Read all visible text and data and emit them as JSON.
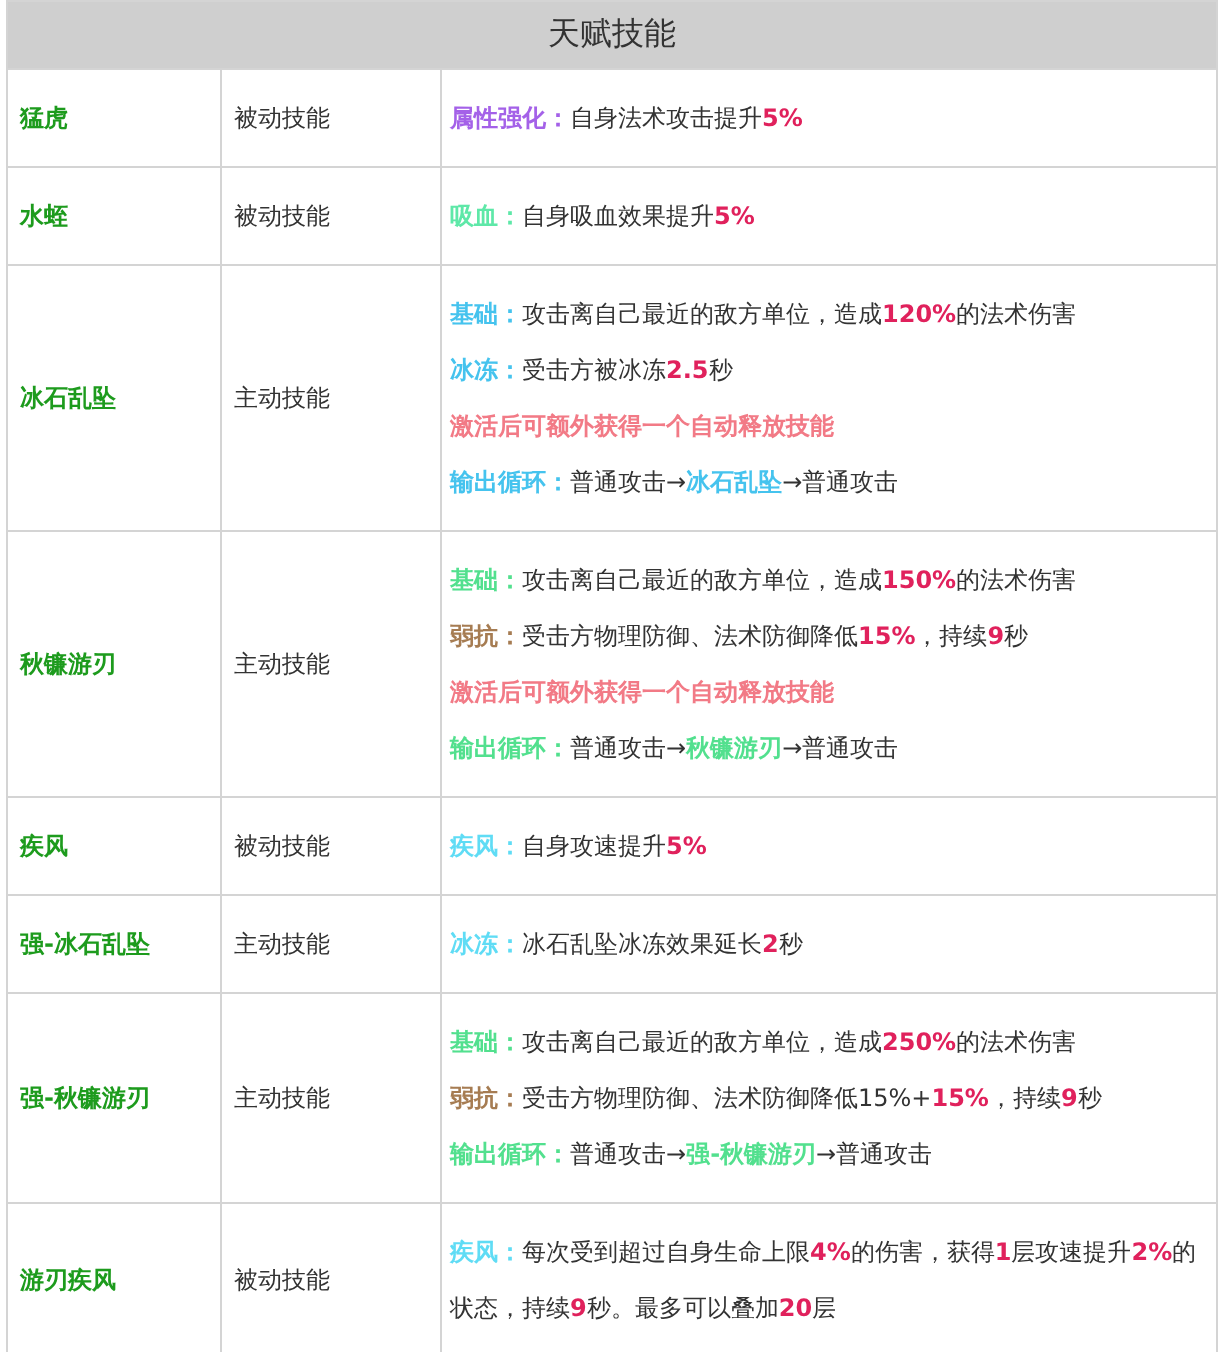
{
  "table": {
    "title": "天赋技能",
    "rows": [
      {
        "name": "猛虎",
        "type": "被动技能",
        "lines": [
          [
            {
              "kind": "label",
              "text": "属性强化：",
              "color": "#a461e8"
            },
            {
              "kind": "plain",
              "text": "自身法术攻击提升"
            },
            {
              "kind": "number",
              "text": "5%"
            }
          ]
        ]
      },
      {
        "name": "水蛭",
        "type": "被动技能",
        "lines": [
          [
            {
              "kind": "label",
              "text": "吸血：",
              "color": "#5ee8a8"
            },
            {
              "kind": "plain",
              "text": "自身吸血效果提升"
            },
            {
              "kind": "number",
              "text": "5%"
            }
          ]
        ]
      },
      {
        "name": "冰石乱坠",
        "type": "主动技能",
        "lines": [
          [
            {
              "kind": "label",
              "text": "基础：",
              "color": "#45c3ee"
            },
            {
              "kind": "plain",
              "text": "攻击离自己最近的敌方单位，造成"
            },
            {
              "kind": "number",
              "text": "120%"
            },
            {
              "kind": "plain",
              "text": "的法术伤害"
            }
          ],
          [
            {
              "kind": "label",
              "text": "冰冻：",
              "color": "#45c3ee"
            },
            {
              "kind": "plain",
              "text": "受击方被冰冻"
            },
            {
              "kind": "number",
              "text": "2.5"
            },
            {
              "kind": "plain",
              "text": "秒"
            }
          ],
          [
            {
              "kind": "label",
              "text": "激活后可额外获得一个自动释放技能",
              "color": "#f27a86"
            }
          ],
          [
            {
              "kind": "label",
              "text": "输出循环：",
              "color": "#45c3ee"
            },
            {
              "kind": "plain",
              "text": "普通攻击→"
            },
            {
              "kind": "label",
              "text": "冰石乱坠",
              "color": "#45c3ee"
            },
            {
              "kind": "plain",
              "text": "→普通攻击"
            }
          ]
        ]
      },
      {
        "name": "秋镰游刃",
        "type": "主动技能",
        "lines": [
          [
            {
              "kind": "label",
              "text": "基础：",
              "color": "#52e08e"
            },
            {
              "kind": "plain",
              "text": "攻击离自己最近的敌方单位，造成"
            },
            {
              "kind": "number",
              "text": "150%"
            },
            {
              "kind": "plain",
              "text": "的法术伤害"
            }
          ],
          [
            {
              "kind": "label",
              "text": "弱抗：",
              "color": "#a67c52"
            },
            {
              "kind": "plain",
              "text": "受击方物理防御、法术防御降低"
            },
            {
              "kind": "number",
              "text": "15%"
            },
            {
              "kind": "plain",
              "text": "，持续"
            },
            {
              "kind": "number",
              "text": "9"
            },
            {
              "kind": "plain",
              "text": "秒"
            }
          ],
          [
            {
              "kind": "label",
              "text": "激活后可额外获得一个自动释放技能",
              "color": "#f27a86"
            }
          ],
          [
            {
              "kind": "label",
              "text": "输出循环：",
              "color": "#52e08e"
            },
            {
              "kind": "plain",
              "text": "普通攻击→"
            },
            {
              "kind": "label",
              "text": "秋镰游刃",
              "color": "#52e08e"
            },
            {
              "kind": "plain",
              "text": "→普通攻击"
            }
          ]
        ]
      },
      {
        "name": "疾风",
        "type": "被动技能",
        "lines": [
          [
            {
              "kind": "label",
              "text": "疾风：",
              "color": "#5fdcf5"
            },
            {
              "kind": "plain",
              "text": "自身攻速提升"
            },
            {
              "kind": "number",
              "text": "5%"
            }
          ]
        ]
      },
      {
        "name": "强-冰石乱坠",
        "type": "主动技能",
        "lines": [
          [
            {
              "kind": "label",
              "text": "冰冻：",
              "color": "#5fdcf5"
            },
            {
              "kind": "plain",
              "text": "冰石乱坠冰冻效果延长"
            },
            {
              "kind": "number",
              "text": "2"
            },
            {
              "kind": "plain",
              "text": "秒"
            }
          ]
        ]
      },
      {
        "name": "强-秋镰游刃",
        "type": "主动技能",
        "lines": [
          [
            {
              "kind": "label",
              "text": "基础：",
              "color": "#52e08e"
            },
            {
              "kind": "plain",
              "text": "攻击离自己最近的敌方单位，造成"
            },
            {
              "kind": "number",
              "text": "250%"
            },
            {
              "kind": "plain",
              "text": "的法术伤害"
            }
          ],
          [
            {
              "kind": "label",
              "text": "弱抗：",
              "color": "#a67c52"
            },
            {
              "kind": "plain",
              "text": "受击方物理防御、法术防御降低15%+"
            },
            {
              "kind": "number",
              "text": "15%"
            },
            {
              "kind": "plain",
              "text": "，持续"
            },
            {
              "kind": "number",
              "text": "9"
            },
            {
              "kind": "plain",
              "text": "秒"
            }
          ],
          [
            {
              "kind": "label",
              "text": "输出循环：",
              "color": "#52e08e"
            },
            {
              "kind": "plain",
              "text": "普通攻击→"
            },
            {
              "kind": "label",
              "text": "强-秋镰游刃",
              "color": "#52e08e"
            },
            {
              "kind": "plain",
              "text": "→普通攻击"
            }
          ]
        ]
      },
      {
        "name": "游刃疾风",
        "type": "被动技能",
        "lines": [
          [
            {
              "kind": "label",
              "text": "疾风：",
              "color": "#5fdcf5"
            },
            {
              "kind": "plain",
              "text": "每次受到超过自身生命上限"
            },
            {
              "kind": "number",
              "text": "4%"
            },
            {
              "kind": "plain",
              "text": "的伤害，获得"
            },
            {
              "kind": "number",
              "text": "1"
            },
            {
              "kind": "plain",
              "text": "层攻速提升"
            },
            {
              "kind": "number",
              "text": "2%"
            },
            {
              "kind": "plain",
              "text": "的状态，持续"
            },
            {
              "kind": "number",
              "text": "9"
            },
            {
              "kind": "plain",
              "text": "秒。最多可以叠加"
            },
            {
              "kind": "number",
              "text": "20"
            },
            {
              "kind": "plain",
              "text": "层"
            }
          ]
        ]
      }
    ]
  }
}
